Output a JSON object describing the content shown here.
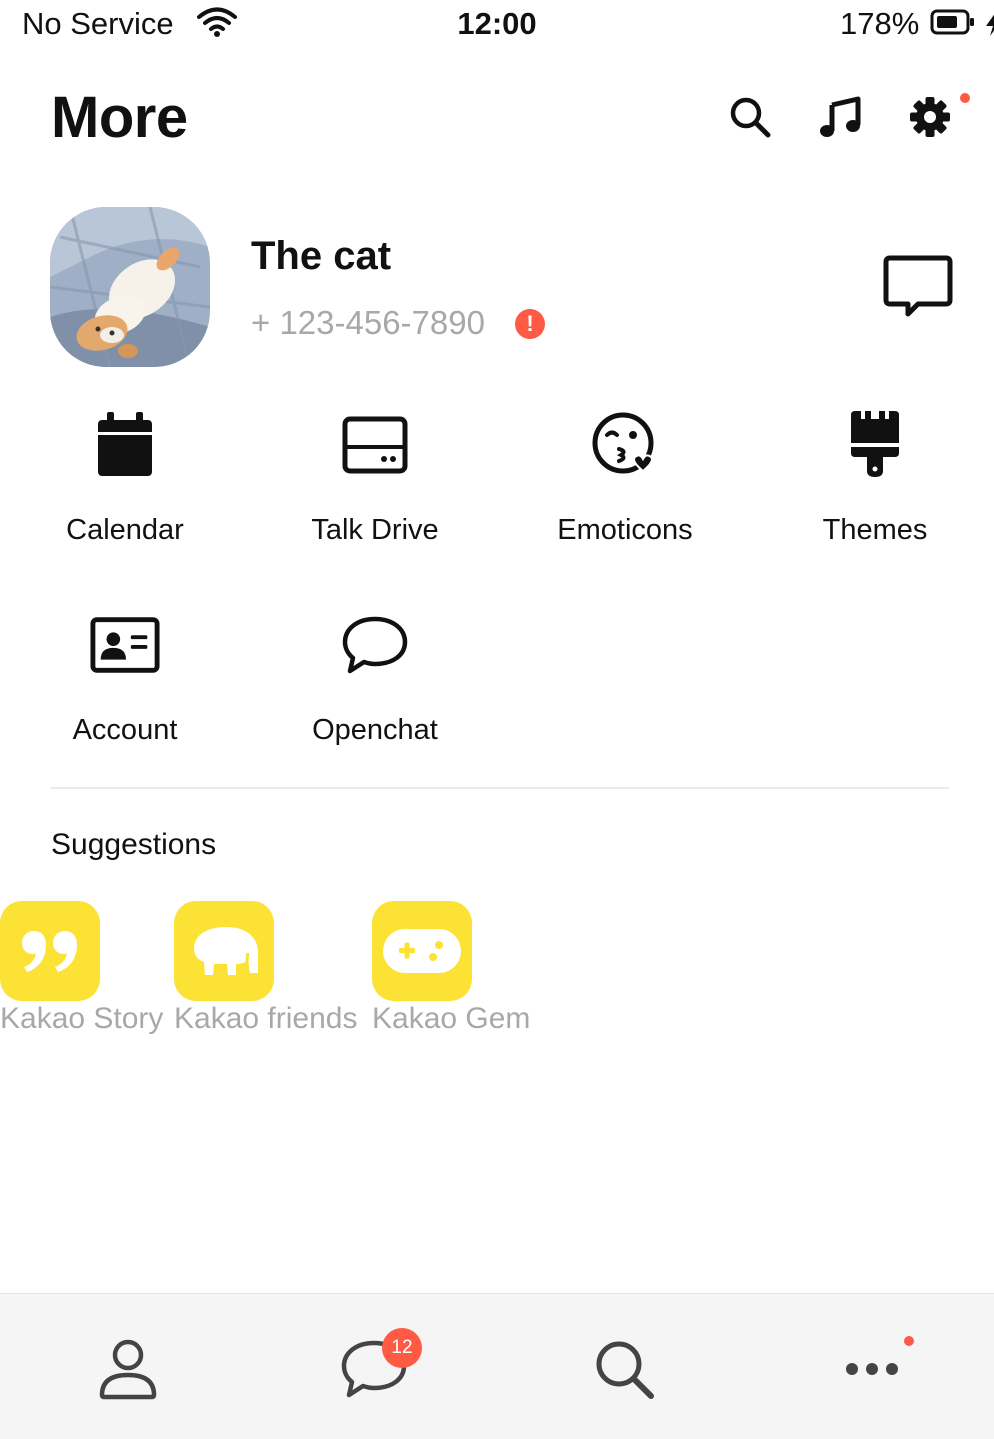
{
  "status_bar": {
    "carrier": "No Service",
    "time": "12:00",
    "battery": "178%"
  },
  "header": {
    "title": "More",
    "icons": [
      "search-icon",
      "music-icon",
      "settings-icon"
    ]
  },
  "profile": {
    "name": "The cat",
    "phone": "+ 123-456-7890",
    "alert": "!"
  },
  "menu": {
    "items": [
      {
        "label": "Calendar",
        "icon": "calendar-icon"
      },
      {
        "label": "Talk Drive",
        "icon": "drive-icon"
      },
      {
        "label": "Emoticons",
        "icon": "emoticon-icon"
      },
      {
        "label": "Themes",
        "icon": "theme-brush-icon"
      },
      {
        "label": "Account",
        "icon": "account-card-icon"
      },
      {
        "label": "Openchat",
        "icon": "chat-bubble-icon"
      }
    ]
  },
  "suggestions": {
    "title": "Suggestions",
    "items": [
      {
        "label": "Kakao Story",
        "icon": "quote-icon"
      },
      {
        "label": "Kakao friends",
        "icon": "elephant-icon"
      },
      {
        "label": "Kakao Gem",
        "icon": "gamepad-icon"
      }
    ],
    "tile_color": "#fbe234"
  },
  "tab_bar": {
    "tabs": [
      "friends-tab",
      "chats-tab",
      "search-tab",
      "more-tab"
    ],
    "chat_badge": "12"
  },
  "colors": {
    "accent_red": "#ff5a44",
    "muted_text": "#a8a8a8",
    "tab_bg": "#f5f5f5"
  }
}
